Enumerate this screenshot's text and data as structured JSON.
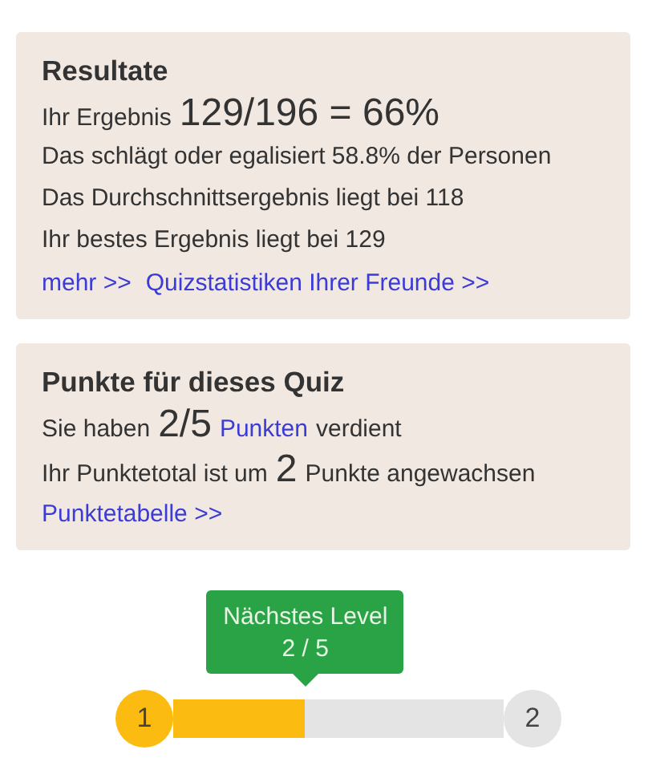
{
  "results": {
    "title": "Resultate",
    "score_line": [
      {
        "kind": "text",
        "text": "Ihr Ergebnis"
      },
      {
        "kind": "big",
        "text": "129/196 = 66%"
      }
    ],
    "lines": [
      "Das schlägt oder egalisiert 58.8% der Personen",
      "Das Durchschnittsergebnis liegt bei 118",
      "Ihr bestes Ergebnis liegt bei 129"
    ],
    "links": [
      "mehr >>",
      "Quizstatistiken Ihrer Freunde >>"
    ]
  },
  "points": {
    "title": "Punkte für dieses Quiz",
    "lines": [
      [
        {
          "kind": "text",
          "text": "Sie haben"
        },
        {
          "kind": "big",
          "text": "2/5"
        },
        {
          "kind": "link",
          "text": "Punkten"
        },
        {
          "kind": "text",
          "text": "verdient"
        }
      ],
      [
        {
          "kind": "text",
          "text": "Ihr Punktetotal ist um"
        },
        {
          "kind": "big",
          "text": "2"
        },
        {
          "kind": "text",
          "text": "Punkte angewachsen"
        }
      ]
    ],
    "links": [
      "Punktetabelle >>"
    ]
  },
  "level_progress": {
    "tooltip_title": "Nächstes Level",
    "tooltip_value": "2 / 5",
    "from": "1",
    "to": "2",
    "level": 0.4
  }
}
